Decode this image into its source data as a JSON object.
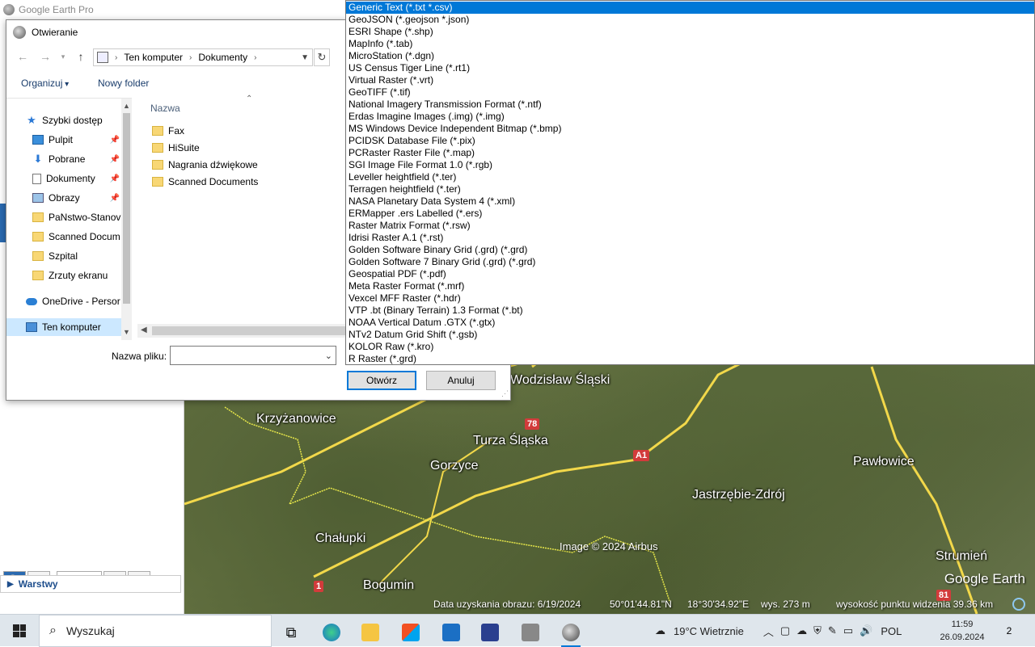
{
  "app": {
    "title": "Google Earth Pro"
  },
  "left_panel": {
    "layers_label": "Warstwy"
  },
  "map": {
    "places": [
      {
        "name": "Wodzisław Śląski",
        "id": "wodzislaw"
      },
      {
        "name": "Krzyżanowice",
        "id": "krzyzanowice"
      },
      {
        "name": "Turza Śląska",
        "id": "turza"
      },
      {
        "name": "Gorzyce",
        "id": "gorzyce"
      },
      {
        "name": "Pawłowice",
        "id": "pawlowice"
      },
      {
        "name": "Jastrzębie-Zdrój",
        "id": "jastrzebie"
      },
      {
        "name": "Chałupki",
        "id": "chalupki"
      },
      {
        "name": "Bogumin",
        "id": "bogumin"
      },
      {
        "name": "Strumień",
        "id": "strumien"
      }
    ],
    "road_badges": [
      "78",
      "A1",
      "1",
      "81"
    ],
    "credit": "Image © 2024 Airbus",
    "brand": "Google Earth",
    "status": {
      "date": "Data uzyskania obrazu: 6/19/2024",
      "lat": "50°01'44.81\"N",
      "lon": "18°30'34.92\"E",
      "elev": "wys.  273 m",
      "eye": "wysokość punktu widzenia  39.36 km"
    }
  },
  "dialog": {
    "title": "Otwieranie",
    "address": {
      "root": "Ten komputer",
      "folder": "Dokumenty"
    },
    "toolbar": {
      "organize": "Organizuj",
      "new_folder": "Nowy folder"
    },
    "nav_items": [
      {
        "label": "Szybki dostęp",
        "icon": "star-icon"
      },
      {
        "label": "Pulpit",
        "icon": "desktop-icon",
        "pinned": true
      },
      {
        "label": "Pobrane",
        "icon": "download-icon",
        "pinned": true
      },
      {
        "label": "Dokumenty",
        "icon": "document-icon",
        "pinned": true
      },
      {
        "label": "Obrazy",
        "icon": "pictures-icon",
        "pinned": true
      },
      {
        "label": "PaNstwo-Stanov",
        "icon": "folder-icon"
      },
      {
        "label": "Scanned Docum",
        "icon": "folder-icon"
      },
      {
        "label": "Szpital",
        "icon": "folder-icon"
      },
      {
        "label": "Zrzuty ekranu",
        "icon": "folder-icon"
      },
      {
        "label": "OneDrive - Persor",
        "icon": "onedrive-icon"
      },
      {
        "label": "Ten komputer",
        "icon": "computer-icon",
        "selected": true
      }
    ],
    "column_header": "Nazwa",
    "files": [
      "Fax",
      "HiSuite",
      "Nagrania dźwiękowe",
      "Scanned Documents"
    ],
    "filename_label": "Nazwa pliku:",
    "filename_value": "",
    "open_button": "Otwórz",
    "cancel_button": "Anuluj"
  },
  "file_types": [
    "Generic Text (*.txt *.csv)",
    "GeoJSON (*.geojson *.json)",
    "ESRI Shape (*.shp)",
    "MapInfo (*.tab)",
    "MicroStation (*.dgn)",
    "US Census Tiger Line (*.rt1)",
    "Virtual Raster (*.vrt)",
    "GeoTIFF (*.tif)",
    "National Imagery Transmission Format (*.ntf)",
    "Erdas Imagine Images (.img) (*.img)",
    "MS Windows Device Independent Bitmap (*.bmp)",
    "PCIDSK Database File (*.pix)",
    "PCRaster Raster File (*.map)",
    "SGI Image File Format 1.0 (*.rgb)",
    "Leveller heightfield (*.ter)",
    "Terragen heightfield (*.ter)",
    "NASA Planetary Data System 4 (*.xml)",
    "ERMapper .ers Labelled (*.ers)",
    "Raster Matrix Format (*.rsw)",
    "Idrisi Raster A.1 (*.rst)",
    "Golden Software Binary Grid (.grd) (*.grd)",
    "Golden Software 7 Binary Grid (.grd) (*.grd)",
    "Geospatial PDF (*.pdf)",
    "Meta Raster Format (*.mrf)",
    "Vexcel MFF Raster (*.hdr)",
    "VTP .bt (Binary Terrain) 1.3 Format (*.bt)",
    "NOAA Vertical Datum .GTX (*.gtx)",
    "NTv2 Datum Grid Shift (*.gsb)",
    "KOLOR Raw (*.kro)",
    "R Raster (*.grd)"
  ],
  "file_type_selected": "Generic Text (*.txt *.csv)",
  "taskbar": {
    "search_placeholder": "Wyszukaj",
    "weather": "19°C  Wietrznie",
    "language": "POL",
    "time": "11:59",
    "date": "26.09.2024",
    "notifications": "2",
    "colors": {
      "accent": "#0078d7"
    }
  }
}
